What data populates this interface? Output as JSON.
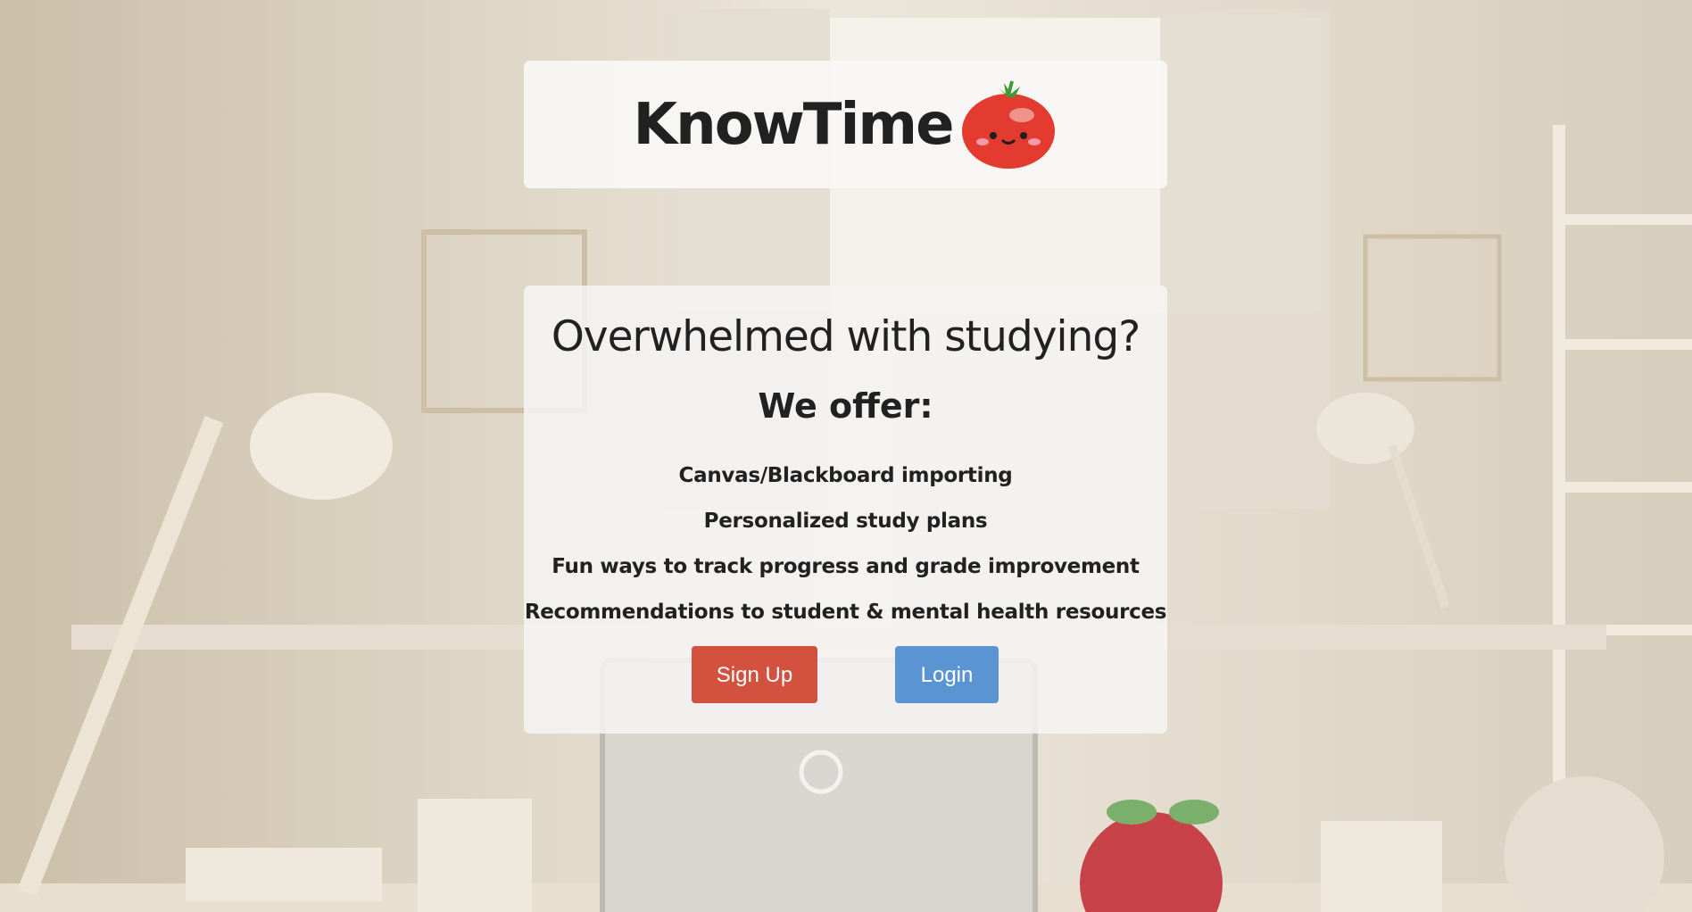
{
  "header": {
    "title": "KnowTime",
    "logo_icon": "tomato-icon"
  },
  "hero": {
    "headline": "Overwhelmed with studying?",
    "offer_title": "We offer:",
    "features": [
      "Canvas/Blackboard importing",
      "Personalized study plans",
      "Fun ways to track progress and grade improvement",
      "Recommendations to student & mental health resources"
    ]
  },
  "actions": {
    "signup_label": "Sign Up",
    "login_label": "Login"
  },
  "colors": {
    "signup": "#d2513f",
    "login": "#5a94d3",
    "card": "#f7f6f4",
    "background": "#e9e1d3"
  }
}
